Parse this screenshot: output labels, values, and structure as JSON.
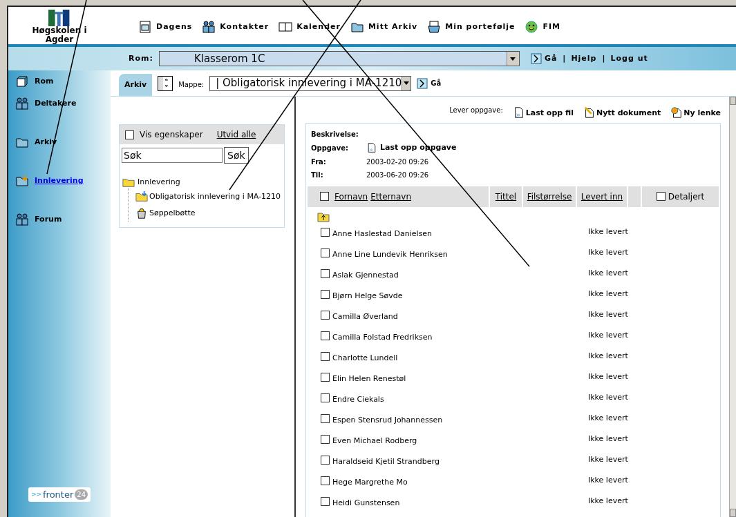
{
  "logo": {
    "name": "Høgskolen i Agder"
  },
  "top_nav": [
    {
      "label": "Dagens"
    },
    {
      "label": "Kontakter"
    },
    {
      "label": "Kalender"
    },
    {
      "label": "Mitt Arkiv"
    },
    {
      "label": "Min portefølje"
    },
    {
      "label": "FIM"
    }
  ],
  "room_bar": {
    "label": "Rom:",
    "value": "Klasserom 1C",
    "go": "Gå",
    "links": [
      {
        "separator": "|",
        "label": "Hjelp"
      },
      {
        "separator": "|",
        "label": "Logg ut"
      }
    ]
  },
  "sidebar": {
    "items": [
      {
        "label": "Rom",
        "selected": false
      },
      {
        "label": "Deltakere",
        "selected": false
      },
      {
        "label": "Arkiv",
        "selected": false
      },
      {
        "label": "Innlevering",
        "selected": true
      }
    ],
    "forum": {
      "label": "Forum",
      "selected": false
    },
    "brand": {
      "prefix": ">>",
      "name": "fronter",
      "badge": "24"
    }
  },
  "toolbar": {
    "tab": "Arkiv",
    "folder_label": "Mappe:",
    "folder_value": "|  Obligatorisk innlevering i MA-1210",
    "go": "Gå"
  },
  "tree_panel": {
    "show_properties": {
      "label": "Vis egenskaper",
      "checked": false
    },
    "expand_all": "Utvid alle",
    "search": {
      "value": "Søk",
      "button": "Søk"
    },
    "tree": [
      {
        "label": "Innlevering",
        "children": [
          {
            "label": "Obligatorisk innlevering i MA-1210"
          },
          {
            "label": "Søppelbøtte"
          }
        ]
      }
    ]
  },
  "deliver": {
    "label": "Lever oppgave:",
    "actions": [
      {
        "label": "Last opp fil"
      },
      {
        "label": "Nytt dokument"
      },
      {
        "label": "Ny lenke"
      }
    ]
  },
  "assignment": {
    "description_label": "Beskrivelse:",
    "task_label": "Oppgave:",
    "task_link": "Last opp oppgave",
    "from_label": "Fra:",
    "from": "2003-02-20 09:26",
    "to_label": "Til:",
    "to": "2003-06-20 09:26"
  },
  "table": {
    "select_all": {
      "checked": false
    },
    "columns": [
      "Fornavn",
      "Etternavn",
      "Tittel",
      "Filstørrelse",
      "Levert inn"
    ],
    "detailed": {
      "label": "Detaljert",
      "checked": false
    },
    "rows": [
      {
        "name": "Anne Haslestad Danielsen",
        "checked": false,
        "status": "Ikke levert"
      },
      {
        "name": "Anne Line Lundevik Henriksen",
        "checked": false,
        "status": "Ikke levert"
      },
      {
        "name": "Aslak Gjennestad",
        "checked": false,
        "status": "Ikke levert"
      },
      {
        "name": "Bjørn Helge Søvde",
        "checked": false,
        "status": "Ikke levert"
      },
      {
        "name": "Camilla Øverland",
        "checked": false,
        "status": "Ikke levert"
      },
      {
        "name": "Camilla Folstad Fredriksen",
        "checked": false,
        "status": "Ikke levert"
      },
      {
        "name": "Charlotte Lundell",
        "checked": false,
        "status": "Ikke levert"
      },
      {
        "name": "Elin Helen Renestøl",
        "checked": false,
        "status": "Ikke levert"
      },
      {
        "name": "Endre Ciekals",
        "checked": false,
        "status": "Ikke levert"
      },
      {
        "name": "Espen Stensrud Johannessen",
        "checked": false,
        "status": "Ikke levert"
      },
      {
        "name": "Even Michael Rodberg",
        "checked": false,
        "status": "Ikke levert"
      },
      {
        "name": "Haraldseid Kjetil Strandberg",
        "checked": false,
        "status": "Ikke levert"
      },
      {
        "name": "Hege Margrethe Mo",
        "checked": false,
        "status": "Ikke levert"
      },
      {
        "name": "Heidi Gunstensen",
        "checked": false,
        "status": "Ikke levert"
      }
    ]
  }
}
